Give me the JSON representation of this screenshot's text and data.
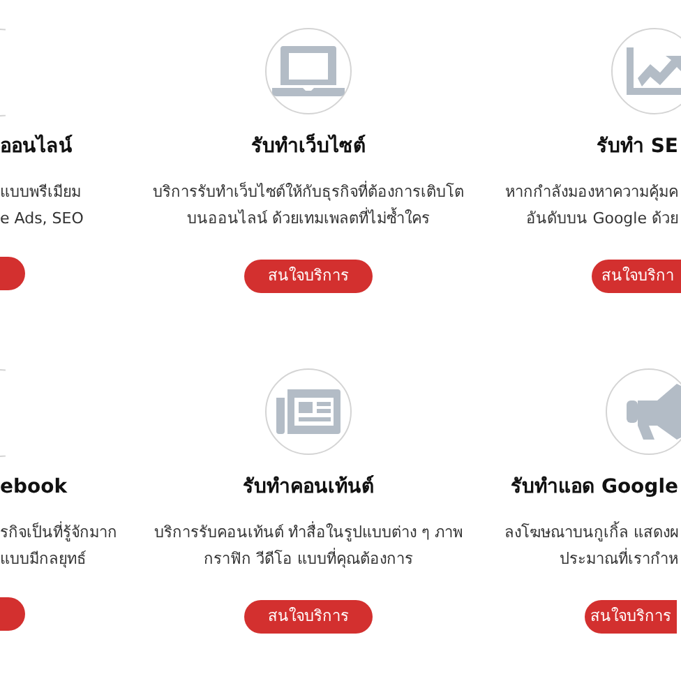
{
  "rows": [
    {
      "cards": [
        {
          "kind": "clipped_left",
          "title": "ออนไลน์",
          "description": [
            "แบบพรีเมียม",
            "e Ads, SEO"
          ]
        },
        {
          "kind": "full",
          "title": "รับทำเว็บไซต์",
          "description": [
            "บริการรับทำเว็บไซต์ให้กับธุรกิจที่ต้องการเติบโต",
            "บนออนไลน์ ด้วยเทมเพลตที่ไม่ซ้ำใคร"
          ],
          "button": "สนใจบริการ"
        },
        {
          "kind": "clipped_right",
          "title": "รับทำ SE",
          "description": [
            "หากกำลังมองหาความคุ้มค",
            "อันดับบน Google ด้วย"
          ],
          "button": "สนใจบริกา"
        }
      ]
    },
    {
      "cards": [
        {
          "kind": "clipped_left",
          "title": "ebook",
          "description": [
            "รกิจเป็นที่รู้จักมาก",
            "แบบมีกลยุทธ์"
          ]
        },
        {
          "kind": "full",
          "title": "รับทำคอนเท้นต์",
          "description": [
            "บริการรับคอนเท้นต์ ทำสื่อในรูปแบบต่าง ๆ ภาพ",
            "กราฟิก วีดีโอ แบบที่คุณต้องการ"
          ],
          "button": "สนใจบริการ"
        },
        {
          "kind": "clipped_right",
          "title": "รับทำแอด Google",
          "description": [
            "ลงโฆษณาบนกูเกิ้ล แสดงผ",
            "ประมาณที่เรากำห"
          ],
          "button": "สนใจบริการ"
        }
      ]
    }
  ]
}
